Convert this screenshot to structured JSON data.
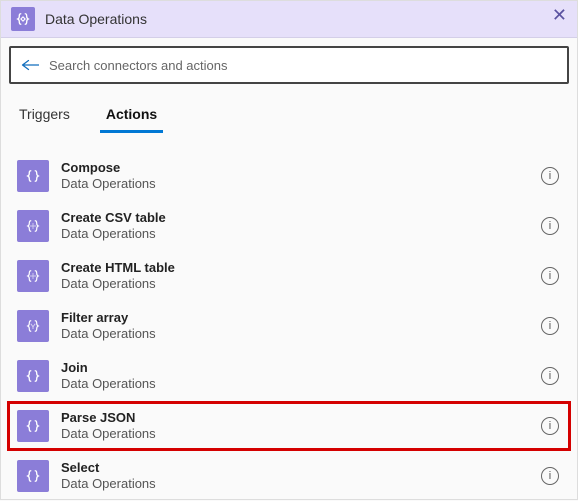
{
  "header": {
    "title": "Data Operations",
    "close_label": "✕",
    "brand_icon": "braces-diamond-icon"
  },
  "search": {
    "placeholder": "Search connectors and actions",
    "back_icon": "back-arrow-icon"
  },
  "tabs": [
    {
      "id": "triggers",
      "label": "Triggers",
      "active": false
    },
    {
      "id": "actions",
      "label": "Actions",
      "active": true
    }
  ],
  "connector_name": "Data Operations",
  "info_glyph": "i",
  "actions": [
    {
      "name": "Compose",
      "icon": "braces-icon",
      "highlighted": false
    },
    {
      "name": "Create CSV table",
      "icon": "table-braces-icon",
      "highlighted": false
    },
    {
      "name": "Create HTML table",
      "icon": "table-braces-icon",
      "highlighted": false
    },
    {
      "name": "Filter array",
      "icon": "filter-braces-icon",
      "highlighted": false
    },
    {
      "name": "Join",
      "icon": "braces-icon",
      "highlighted": false
    },
    {
      "name": "Parse JSON",
      "icon": "braces-icon",
      "highlighted": true
    },
    {
      "name": "Select",
      "icon": "braces-icon",
      "highlighted": false
    }
  ],
  "colors": {
    "accent": "#8b7dd8",
    "header_bg": "#e6e0fa",
    "tab_active": "#0078d4",
    "highlight_border": "#d40000"
  }
}
